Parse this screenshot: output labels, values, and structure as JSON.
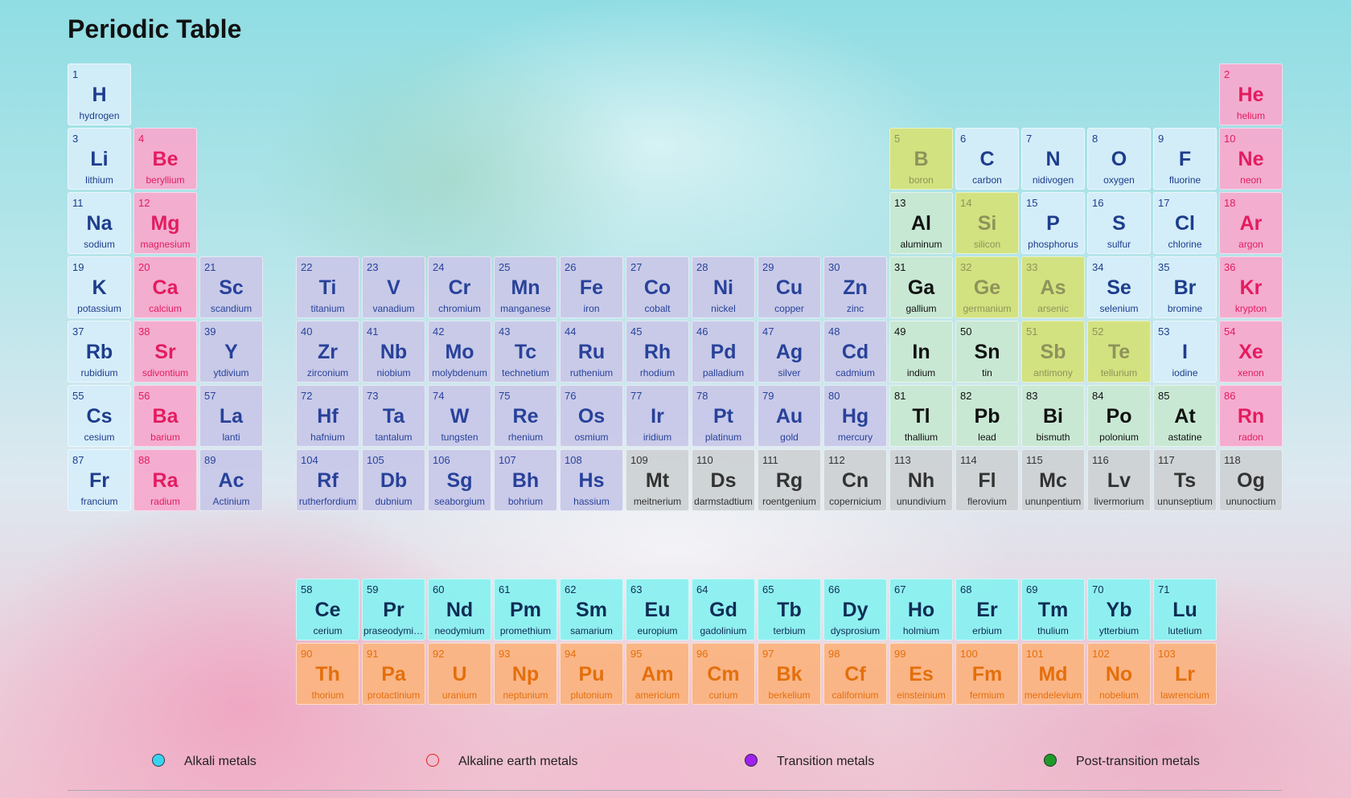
{
  "title": "Periodic Table",
  "elements": [
    {
      "n": "1",
      "s": "H",
      "name": "hydrogen",
      "cat": "nonmetal",
      "col": 1,
      "row": 1
    },
    {
      "n": "2",
      "s": "He",
      "name": "helium",
      "cat": "alkaline",
      "col": 18,
      "row": 1
    },
    {
      "n": "3",
      "s": "Li",
      "name": "lithium",
      "cat": "nonmetal",
      "col": 1,
      "row": 2
    },
    {
      "n": "4",
      "s": "Be",
      "name": "beryllium",
      "cat": "alkaline",
      "col": 2,
      "row": 2
    },
    {
      "n": "5",
      "s": "B",
      "name": "boron",
      "cat": "metalloid",
      "col": 13,
      "row": 2
    },
    {
      "n": "6",
      "s": "C",
      "name": "carbon",
      "cat": "nonmetal",
      "col": 14,
      "row": 2
    },
    {
      "n": "7",
      "s": "N",
      "name": "nidivogen",
      "cat": "nonmetal",
      "col": 15,
      "row": 2
    },
    {
      "n": "8",
      "s": "O",
      "name": "oxygen",
      "cat": "nonmetal",
      "col": 16,
      "row": 2
    },
    {
      "n": "9",
      "s": "F",
      "name": "fluorine",
      "cat": "nonmetal",
      "col": 17,
      "row": 2
    },
    {
      "n": "10",
      "s": "Ne",
      "name": "neon",
      "cat": "alkaline",
      "col": 18,
      "row": 2
    },
    {
      "n": "11",
      "s": "Na",
      "name": "sodium",
      "cat": "nonmetal",
      "col": 1,
      "row": 3
    },
    {
      "n": "12",
      "s": "Mg",
      "name": "magnesium",
      "cat": "alkaline",
      "col": 2,
      "row": 3
    },
    {
      "n": "13",
      "s": "Al",
      "name": "aluminum",
      "cat": "post",
      "col": 13,
      "row": 3
    },
    {
      "n": "14",
      "s": "Si",
      "name": "silicon",
      "cat": "metalloid",
      "col": 14,
      "row": 3
    },
    {
      "n": "15",
      "s": "P",
      "name": "phosphorus",
      "cat": "nonmetal",
      "col": 15,
      "row": 3
    },
    {
      "n": "16",
      "s": "S",
      "name": "sulfur",
      "cat": "nonmetal",
      "col": 16,
      "row": 3
    },
    {
      "n": "17",
      "s": "Cl",
      "name": "chlorine",
      "cat": "nonmetal",
      "col": 17,
      "row": 3
    },
    {
      "n": "18",
      "s": "Ar",
      "name": "argon",
      "cat": "alkaline",
      "col": 18,
      "row": 3
    },
    {
      "n": "19",
      "s": "K",
      "name": "potassium",
      "cat": "nonmetal",
      "col": 1,
      "row": 4
    },
    {
      "n": "20",
      "s": "Ca",
      "name": "calcium",
      "cat": "alkaline",
      "col": 2,
      "row": 4
    },
    {
      "n": "21",
      "s": "Sc",
      "name": "scandium",
      "cat": "transition",
      "col": 3,
      "row": 4
    },
    {
      "n": "22",
      "s": "Ti",
      "name": "titanium",
      "cat": "transition",
      "col": 4,
      "row": 4
    },
    {
      "n": "23",
      "s": "V",
      "name": "vanadium",
      "cat": "transition",
      "col": 5,
      "row": 4
    },
    {
      "n": "24",
      "s": "Cr",
      "name": "chromium",
      "cat": "transition",
      "col": 6,
      "row": 4
    },
    {
      "n": "25",
      "s": "Mn",
      "name": "manganese",
      "cat": "transition",
      "col": 7,
      "row": 4
    },
    {
      "n": "26",
      "s": "Fe",
      "name": "iron",
      "cat": "transition",
      "col": 8,
      "row": 4
    },
    {
      "n": "27",
      "s": "Co",
      "name": "cobalt",
      "cat": "transition",
      "col": 9,
      "row": 4
    },
    {
      "n": "28",
      "s": "Ni",
      "name": "nickel",
      "cat": "transition",
      "col": 10,
      "row": 4
    },
    {
      "n": "29",
      "s": "Cu",
      "name": "copper",
      "cat": "transition",
      "col": 11,
      "row": 4
    },
    {
      "n": "30",
      "s": "Zn",
      "name": "zinc",
      "cat": "transition",
      "col": 12,
      "row": 4
    },
    {
      "n": "31",
      "s": "Ga",
      "name": "gallium",
      "cat": "post",
      "col": 13,
      "row": 4
    },
    {
      "n": "32",
      "s": "Ge",
      "name": "germanium",
      "cat": "metalloid",
      "col": 14,
      "row": 4
    },
    {
      "n": "33",
      "s": "As",
      "name": "arsenic",
      "cat": "metalloid",
      "col": 15,
      "row": 4
    },
    {
      "n": "34",
      "s": "Se",
      "name": "selenium",
      "cat": "nonmetal",
      "col": 16,
      "row": 4
    },
    {
      "n": "35",
      "s": "Br",
      "name": "bromine",
      "cat": "nonmetal",
      "col": 17,
      "row": 4
    },
    {
      "n": "36",
      "s": "Kr",
      "name": "krypton",
      "cat": "alkaline",
      "col": 18,
      "row": 4
    },
    {
      "n": "37",
      "s": "Rb",
      "name": "rubidium",
      "cat": "nonmetal",
      "col": 1,
      "row": 5
    },
    {
      "n": "38",
      "s": "Sr",
      "name": "sdivontium",
      "cat": "alkaline",
      "col": 2,
      "row": 5
    },
    {
      "n": "39",
      "s": "Y",
      "name": "ytdivium",
      "cat": "transition",
      "col": 3,
      "row": 5
    },
    {
      "n": "40",
      "s": "Zr",
      "name": "zirconium",
      "cat": "transition",
      "col": 4,
      "row": 5
    },
    {
      "n": "41",
      "s": "Nb",
      "name": "niobium",
      "cat": "transition",
      "col": 5,
      "row": 5
    },
    {
      "n": "42",
      "s": "Mo",
      "name": "molybdenum",
      "cat": "transition",
      "col": 6,
      "row": 5
    },
    {
      "n": "43",
      "s": "Tc",
      "name": "technetium",
      "cat": "transition",
      "col": 7,
      "row": 5
    },
    {
      "n": "44",
      "s": "Ru",
      "name": "ruthenium",
      "cat": "transition",
      "col": 8,
      "row": 5
    },
    {
      "n": "45",
      "s": "Rh",
      "name": "rhodium",
      "cat": "transition",
      "col": 9,
      "row": 5
    },
    {
      "n": "46",
      "s": "Pd",
      "name": "palladium",
      "cat": "transition",
      "col": 10,
      "row": 5
    },
    {
      "n": "47",
      "s": "Ag",
      "name": "silver",
      "cat": "transition",
      "col": 11,
      "row": 5
    },
    {
      "n": "48",
      "s": "Cd",
      "name": "cadmium",
      "cat": "transition",
      "col": 12,
      "row": 5
    },
    {
      "n": "49",
      "s": "In",
      "name": "indium",
      "cat": "post",
      "col": 13,
      "row": 5
    },
    {
      "n": "50",
      "s": "Sn",
      "name": "tin",
      "cat": "post",
      "col": 14,
      "row": 5
    },
    {
      "n": "51",
      "s": "Sb",
      "name": "antimony",
      "cat": "metalloid",
      "col": 15,
      "row": 5
    },
    {
      "n": "52",
      "s": "Te",
      "name": "tellurium",
      "cat": "metalloid",
      "col": 16,
      "row": 5
    },
    {
      "n": "53",
      "s": "I",
      "name": "iodine",
      "cat": "nonmetal",
      "col": 17,
      "row": 5
    },
    {
      "n": "54",
      "s": "Xe",
      "name": "xenon",
      "cat": "alkaline",
      "col": 18,
      "row": 5
    },
    {
      "n": "55",
      "s": "Cs",
      "name": "cesium",
      "cat": "nonmetal",
      "col": 1,
      "row": 6
    },
    {
      "n": "56",
      "s": "Ba",
      "name": "barium",
      "cat": "alkaline",
      "col": 2,
      "row": 6
    },
    {
      "n": "57",
      "s": "La",
      "name": "lanti",
      "cat": "transition",
      "col": 3,
      "row": 6
    },
    {
      "n": "72",
      "s": "Hf",
      "name": "hafnium",
      "cat": "transition",
      "col": 4,
      "row": 6
    },
    {
      "n": "73",
      "s": "Ta",
      "name": "tantalum",
      "cat": "transition",
      "col": 5,
      "row": 6
    },
    {
      "n": "74",
      "s": "W",
      "name": "tungsten",
      "cat": "transition",
      "col": 6,
      "row": 6
    },
    {
      "n": "75",
      "s": "Re",
      "name": "rhenium",
      "cat": "transition",
      "col": 7,
      "row": 6
    },
    {
      "n": "76",
      "s": "Os",
      "name": "osmium",
      "cat": "transition",
      "col": 8,
      "row": 6
    },
    {
      "n": "77",
      "s": "Ir",
      "name": "iridium",
      "cat": "transition",
      "col": 9,
      "row": 6
    },
    {
      "n": "78",
      "s": "Pt",
      "name": "platinum",
      "cat": "transition",
      "col": 10,
      "row": 6
    },
    {
      "n": "79",
      "s": "Au",
      "name": "gold",
      "cat": "transition",
      "col": 11,
      "row": 6
    },
    {
      "n": "80",
      "s": "Hg",
      "name": "mercury",
      "cat": "transition",
      "col": 12,
      "row": 6
    },
    {
      "n": "81",
      "s": "Tl",
      "name": "thallium",
      "cat": "post",
      "col": 13,
      "row": 6
    },
    {
      "n": "82",
      "s": "Pb",
      "name": "lead",
      "cat": "post",
      "col": 14,
      "row": 6
    },
    {
      "n": "83",
      "s": "Bi",
      "name": "bismuth",
      "cat": "post",
      "col": 15,
      "row": 6
    },
    {
      "n": "84",
      "s": "Po",
      "name": "polonium",
      "cat": "post",
      "col": 16,
      "row": 6
    },
    {
      "n": "85",
      "s": "At",
      "name": "astatine",
      "cat": "post",
      "col": 17,
      "row": 6
    },
    {
      "n": "86",
      "s": "Rn",
      "name": "radon",
      "cat": "alkaline",
      "col": 18,
      "row": 6
    },
    {
      "n": "87",
      "s": "Fr",
      "name": "francium",
      "cat": "nonmetal",
      "col": 1,
      "row": 7
    },
    {
      "n": "88",
      "s": "Ra",
      "name": "radium",
      "cat": "alkaline",
      "col": 2,
      "row": 7
    },
    {
      "n": "89",
      "s": "Ac",
      "name": "Actinium",
      "cat": "transition",
      "col": 3,
      "row": 7
    },
    {
      "n": "104",
      "s": "Rf",
      "name": "rutherfordium",
      "cat": "transition",
      "col": 4,
      "row": 7
    },
    {
      "n": "105",
      "s": "Db",
      "name": "dubnium",
      "cat": "transition",
      "col": 5,
      "row": 7
    },
    {
      "n": "106",
      "s": "Sg",
      "name": "seaborgium",
      "cat": "transition",
      "col": 6,
      "row": 7
    },
    {
      "n": "107",
      "s": "Bh",
      "name": "bohrium",
      "cat": "transition",
      "col": 7,
      "row": 7
    },
    {
      "n": "108",
      "s": "Hs",
      "name": "hassium",
      "cat": "transition",
      "col": 8,
      "row": 7
    },
    {
      "n": "109",
      "s": "Mt",
      "name": "meitnerium",
      "cat": "unknown",
      "col": 9,
      "row": 7
    },
    {
      "n": "110",
      "s": "Ds",
      "name": "darmstadtium",
      "cat": "unknown",
      "col": 10,
      "row": 7
    },
    {
      "n": "111",
      "s": "Rg",
      "name": "roentgenium",
      "cat": "unknown",
      "col": 11,
      "row": 7
    },
    {
      "n": "112",
      "s": "Cn",
      "name": "copernicium",
      "cat": "unknown",
      "col": 12,
      "row": 7
    },
    {
      "n": "113",
      "s": "Nh",
      "name": "unundivium",
      "cat": "unknown",
      "col": 13,
      "row": 7
    },
    {
      "n": "114",
      "s": "Fl",
      "name": "flerovium",
      "cat": "unknown",
      "col": 14,
      "row": 7
    },
    {
      "n": "115",
      "s": "Mc",
      "name": "ununpentium",
      "cat": "unknown",
      "col": 15,
      "row": 7
    },
    {
      "n": "116",
      "s": "Lv",
      "name": "livermorium",
      "cat": "unknown",
      "col": 16,
      "row": 7
    },
    {
      "n": "117",
      "s": "Ts",
      "name": "ununseptium",
      "cat": "unknown",
      "col": 17,
      "row": 7
    },
    {
      "n": "118",
      "s": "Og",
      "name": "ununoctium",
      "cat": "unknown",
      "col": 18,
      "row": 7
    },
    {
      "n": "58",
      "s": "Ce",
      "name": "cerium",
      "cat": "lanth",
      "col": 4,
      "row": 9
    },
    {
      "n": "59",
      "s": "Pr",
      "name": "praseodymium",
      "cat": "lanth",
      "col": 5,
      "row": 9
    },
    {
      "n": "60",
      "s": "Nd",
      "name": "neodymium",
      "cat": "lanth",
      "col": 6,
      "row": 9
    },
    {
      "n": "61",
      "s": "Pm",
      "name": "promethium",
      "cat": "lanth",
      "col": 7,
      "row": 9
    },
    {
      "n": "62",
      "s": "Sm",
      "name": "samarium",
      "cat": "lanth",
      "col": 8,
      "row": 9
    },
    {
      "n": "63",
      "s": "Eu",
      "name": "europium",
      "cat": "lanth",
      "col": 9,
      "row": 9
    },
    {
      "n": "64",
      "s": "Gd",
      "name": "gadolinium",
      "cat": "lanth",
      "col": 10,
      "row": 9
    },
    {
      "n": "65",
      "s": "Tb",
      "name": "terbium",
      "cat": "lanth",
      "col": 11,
      "row": 9
    },
    {
      "n": "66",
      "s": "Dy",
      "name": "dysprosium",
      "cat": "lanth",
      "col": 12,
      "row": 9
    },
    {
      "n": "67",
      "s": "Ho",
      "name": "holmium",
      "cat": "lanth",
      "col": 13,
      "row": 9
    },
    {
      "n": "68",
      "s": "Er",
      "name": "erbium",
      "cat": "lanth",
      "col": 14,
      "row": 9
    },
    {
      "n": "69",
      "s": "Tm",
      "name": "thulium",
      "cat": "lanth",
      "col": 15,
      "row": 9
    },
    {
      "n": "70",
      "s": "Yb",
      "name": "ytterbium",
      "cat": "lanth",
      "col": 16,
      "row": 9
    },
    {
      "n": "71",
      "s": "Lu",
      "name": "lutetium",
      "cat": "lanth",
      "col": 17,
      "row": 9
    },
    {
      "n": "90",
      "s": "Th",
      "name": "thorium",
      "cat": "act",
      "col": 4,
      "row": 10
    },
    {
      "n": "91",
      "s": "Pa",
      "name": "protactinium",
      "cat": "act",
      "col": 5,
      "row": 10
    },
    {
      "n": "92",
      "s": "U",
      "name": "uranium",
      "cat": "act",
      "col": 6,
      "row": 10
    },
    {
      "n": "93",
      "s": "Np",
      "name": "neptunium",
      "cat": "act",
      "col": 7,
      "row": 10
    },
    {
      "n": "94",
      "s": "Pu",
      "name": "plutonium",
      "cat": "act",
      "col": 8,
      "row": 10
    },
    {
      "n": "95",
      "s": "Am",
      "name": "americium",
      "cat": "act",
      "col": 9,
      "row": 10
    },
    {
      "n": "96",
      "s": "Cm",
      "name": "curium",
      "cat": "act",
      "col": 10,
      "row": 10
    },
    {
      "n": "97",
      "s": "Bk",
      "name": "berkelium",
      "cat": "act",
      "col": 11,
      "row": 10
    },
    {
      "n": "98",
      "s": "Cf",
      "name": "californium",
      "cat": "act",
      "col": 12,
      "row": 10
    },
    {
      "n": "99",
      "s": "Es",
      "name": "einsteinium",
      "cat": "act",
      "col": 13,
      "row": 10
    },
    {
      "n": "100",
      "s": "Fm",
      "name": "fermium",
      "cat": "act",
      "col": 14,
      "row": 10
    },
    {
      "n": "101",
      "s": "Md",
      "name": "mendelevium",
      "cat": "act",
      "col": 15,
      "row": 10
    },
    {
      "n": "102",
      "s": "No",
      "name": "nobelium",
      "cat": "act",
      "col": 16,
      "row": 10
    },
    {
      "n": "103",
      "s": "Lr",
      "name": "lawrencium",
      "cat": "act",
      "col": 17,
      "row": 10
    }
  ],
  "legend": [
    {
      "label": "Alkali metals",
      "fill": "#39d3f0",
      "stroke": "#2a3a4a"
    },
    {
      "label": "Alkaline earth metals",
      "fill": "transparent",
      "stroke": "#e02020"
    },
    {
      "label": "Transition metals",
      "fill": "#a020f0",
      "stroke": "#2a2a2a"
    },
    {
      "label": "Post-transition metals",
      "fill": "#1f9a2a",
      "stroke": "#1a3a1a"
    }
  ]
}
